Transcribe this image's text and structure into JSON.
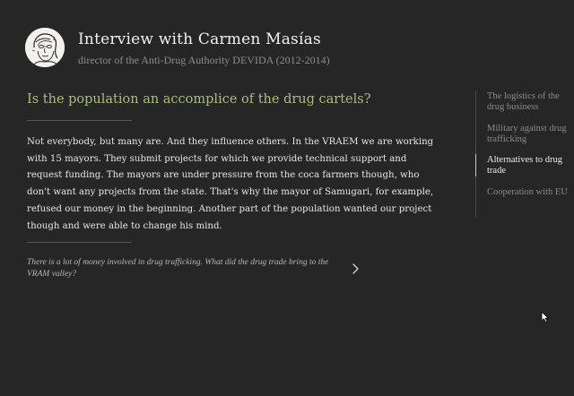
{
  "header": {
    "avatar_icon": "portrait-sketch-icon",
    "title": "Interview with Carmen Masías",
    "subtitle": "director of the Anti-Drug Authority DEVIDA (2012-2014)"
  },
  "main": {
    "question": "Is the population an accomplice of the drug cartels?",
    "answer": "Not everybody, but many are. And they influence others. In the VRAEM we are working with 15 mayors. They submit projects for which we provide technical support and request funding. The mayors are under pressure from the coca farmers though, who don't want any projects from the state. That's why the mayor of Samugari, for example, refused our money in the beginning. Another part of the population wanted our project though and were able to change his mind.",
    "next_question": "There is a lot of money involved in drug trafficking. What did the drug trade bring to the VRAM valley?",
    "next_icon": "chevron-right-icon"
  },
  "sidebar": {
    "items": [
      {
        "label": "The logistics of the drug business",
        "active": false
      },
      {
        "label": "Military against drug trafficking",
        "active": false
      },
      {
        "label": "Alternatives to drug trade",
        "active": true
      },
      {
        "label": "Cooperation with EU",
        "active": false
      }
    ]
  },
  "colors": {
    "background": "#262626",
    "question": "#a9bd7c",
    "title": "#f1f1f1",
    "muted": "#8a8a8a"
  }
}
